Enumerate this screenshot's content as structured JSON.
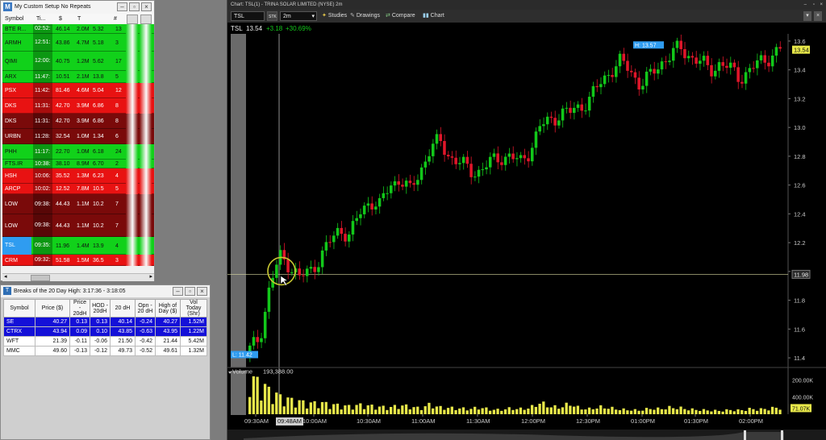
{
  "scanner": {
    "title": "My Custom Setup No Repeats",
    "columns": [
      "Symbol",
      "Ti...",
      "$",
      "T",
      "#"
    ],
    "rows": [
      {
        "symbol": "BTE R...",
        "time": "02:52:",
        "price": "46.14",
        "vol": "2.0M",
        "v2": "5.32",
        "count": "13",
        "color": "#11d11a"
      },
      {
        "symbol": "ARMH",
        "time": "12:51:",
        "price": "43.86",
        "vol": "4.7M",
        "v2": "5.18",
        "count": "3",
        "color": "#11d11a"
      },
      {
        "symbol": "QIMI",
        "time": "12:00:",
        "price": "40.75",
        "vol": "1.2M",
        "v2": "5.62",
        "count": "17",
        "color": "#11d11a"
      },
      {
        "symbol": "ARX",
        "time": "11:47:",
        "price": "10.51",
        "vol": "2.1M",
        "v2": "13.8",
        "count": "5",
        "color": "#11d11a"
      },
      {
        "symbol": "PSX",
        "time": "11:42:",
        "price": "81.46",
        "vol": "4.6M",
        "v2": "5.04",
        "count": "12",
        "color": "#e81212"
      },
      {
        "symbol": "DKS",
        "time": "11:31:",
        "price": "42.70",
        "vol": "3.9M",
        "v2": "6.86",
        "count": "8",
        "color": "#e81212"
      },
      {
        "symbol": "DKS",
        "time": "11:31:",
        "price": "42.70",
        "vol": "3.9M",
        "v2": "6.86",
        "count": "8",
        "color": "#7a0a0a"
      },
      {
        "symbol": "URBN",
        "time": "11:28:",
        "price": "32.54",
        "vol": "1.0M",
        "v2": "1.34",
        "count": "6",
        "color": "#7a0a0a"
      },
      {
        "symbol": "PHH",
        "time": "11:17:",
        "price": "22.70",
        "vol": "1.0M",
        "v2": "6.18",
        "count": "24",
        "color": "#11d11a"
      },
      {
        "symbol": "FTS.IR",
        "time": "10:38:",
        "price": "38.10",
        "vol": "8.9M",
        "v2": "6.70",
        "count": "2",
        "color": "#11d11a"
      },
      {
        "symbol": "HSH",
        "time": "10:06:",
        "price": "35.52",
        "vol": "1.3M",
        "v2": "6.23",
        "count": "4",
        "color": "#e81212"
      },
      {
        "symbol": "ARCP",
        "time": "10:02:",
        "price": "12.52",
        "vol": "7.8M",
        "v2": "10.5",
        "count": "5",
        "color": "#e81212"
      },
      {
        "symbol": "LOW",
        "time": "09:38:",
        "price": "44.43",
        "vol": "1.1M",
        "v2": "10.2",
        "count": "7",
        "color": "#7a0a0a"
      },
      {
        "symbol": "LOW",
        "time": "09:38:",
        "price": "44.43",
        "vol": "1.1M",
        "v2": "10.2",
        "count": "7",
        "color": "#7a0a0a"
      },
      {
        "symbol": "TSL",
        "time": "09:35:",
        "price": "11.96",
        "vol": "1.4M",
        "v2": "13.9",
        "count": "4",
        "color": "#11d11a",
        "symbolColor": "#2f9cf0"
      },
      {
        "symbol": "CRM",
        "time": "09:32:",
        "price": "51.58",
        "vol": "1.5M",
        "v2": "36.5",
        "count": "3",
        "color": "#e81212"
      }
    ]
  },
  "breaks": {
    "title": "Breaks of the 20 Day High: 3:17:36 - 3:18:05",
    "columns": [
      "Symbol",
      "Price ($)",
      "Price - 20dH",
      "HOD - 20dH",
      "20 dH",
      "Opn - 20 dH",
      "High of Day ($)",
      "Vol Today (Shr)"
    ],
    "rows": [
      {
        "cells": [
          "SE",
          "40.27",
          "0.13",
          "0.13",
          "40.14",
          "-0.24",
          "40.27",
          "1.52M"
        ],
        "selected": true
      },
      {
        "cells": [
          "CTRX",
          "43.94",
          "0.09",
          "0.10",
          "43.85",
          "-0.63",
          "43.95",
          "1.22M"
        ],
        "selected": true
      },
      {
        "cells": [
          "WFT",
          "21.39",
          "-0.11",
          "-0.06",
          "21.50",
          "-0.42",
          "21.44",
          "5.42M"
        ],
        "selected": false
      },
      {
        "cells": [
          "MMC",
          "49.60",
          "-0.13",
          "-0.12",
          "49.73",
          "-0.52",
          "49.61",
          "1.32M"
        ],
        "selected": false
      }
    ]
  },
  "chart": {
    "window_title": "Chart: TSL(1) - TRINA SOLAR LIMITED (NYSE) 2m",
    "symbol_input": "TSL",
    "stk_label": "STK",
    "interval": "2m",
    "toolbar": {
      "studies": "Studies",
      "drawings": "Drawings",
      "compare": "Compare",
      "chart": "Chart"
    },
    "quote": {
      "symbol": "TSL",
      "last": "13.54",
      "change": "+3.18",
      "change_pct": "+30.69%"
    },
    "price_axis": [
      "13.6",
      "13.4",
      "13.2",
      "13.0",
      "12.8",
      "12.6",
      "12.4",
      "12.2",
      "12.0",
      "11.8",
      "11.6",
      "11.4"
    ],
    "high_label": "H: 13.57",
    "low_label": "L: 11.42",
    "last_price_tag": "13.54",
    "cursor_price_tag": "11.98",
    "volume_label": "Volume",
    "volume_value": "193,388.00",
    "volume_axis": [
      "400.00K",
      "200.00K"
    ],
    "volume_tag": "71.07K",
    "time_axis": [
      "09:30AM",
      "09:48AM",
      "10:00AM",
      "10:30AM",
      "11:00AM",
      "11:30AM",
      "12:00PM",
      "12:30PM",
      "01:00PM",
      "01:30PM",
      "02:00PM"
    ],
    "colors": {
      "up": "#12c81a",
      "down": "#e0162a",
      "volume": "#e8e84a",
      "grid": "#2a2a2a",
      "highlight": "#2f9cf0"
    }
  },
  "chart_data": {
    "type": "candlestick",
    "title": "TSL 2m",
    "ylim": [
      11.35,
      13.65
    ],
    "y_ticks": [
      11.4,
      11.6,
      11.8,
      12.0,
      12.2,
      12.4,
      12.6,
      12.8,
      13.0,
      13.2,
      13.4,
      13.6
    ],
    "x_ticks": [
      "09:30AM",
      "10:00AM",
      "10:30AM",
      "11:00AM",
      "11:30AM",
      "12:00PM",
      "12:30PM",
      "01:00PM",
      "01:30PM",
      "02:00PM"
    ],
    "high": 13.57,
    "low": 11.42,
    "last": 13.54,
    "close_series": [
      11.45,
      11.55,
      11.9,
      12.1,
      12.05,
      11.95,
      12.0,
      12.1,
      12.2,
      12.3,
      12.25,
      12.4,
      12.5,
      12.45,
      12.6,
      12.65,
      12.55,
      12.7,
      12.85,
      12.9,
      12.8,
      12.75,
      12.7,
      12.7,
      12.75,
      12.8,
      12.8,
      12.75,
      12.85,
      13.0,
      13.05,
      13.1,
      13.1,
      13.15,
      13.2,
      13.3,
      13.4,
      13.45,
      13.4,
      13.3,
      13.35,
      13.45,
      13.5,
      13.55,
      13.5,
      13.45,
      13.4,
      13.45,
      13.4,
      13.35,
      13.4,
      13.45,
      13.5,
      13.54
    ],
    "volume_ylim": [
      0,
      450000
    ],
    "volume_ticks": [
      200000,
      400000
    ],
    "volume_last": 71070,
    "volume_bars": [
      400000,
      320000,
      240000,
      180000,
      150000,
      130000,
      110000,
      120000,
      100000,
      90000,
      80000,
      95000,
      85000,
      75000,
      70000,
      90000,
      80000,
      60000,
      100000,
      70000,
      65000,
      60000,
      55000,
      70000,
      50000,
      45000,
      60000,
      55000,
      65000,
      120000,
      80000,
      70000,
      110000,
      60000,
      55000,
      75000,
      65000,
      50000,
      45000,
      40000,
      60000,
      55000,
      70000,
      65000,
      50000,
      45000,
      40000,
      35000,
      45000,
      40000,
      55000,
      50000,
      60000,
      71070
    ]
  }
}
